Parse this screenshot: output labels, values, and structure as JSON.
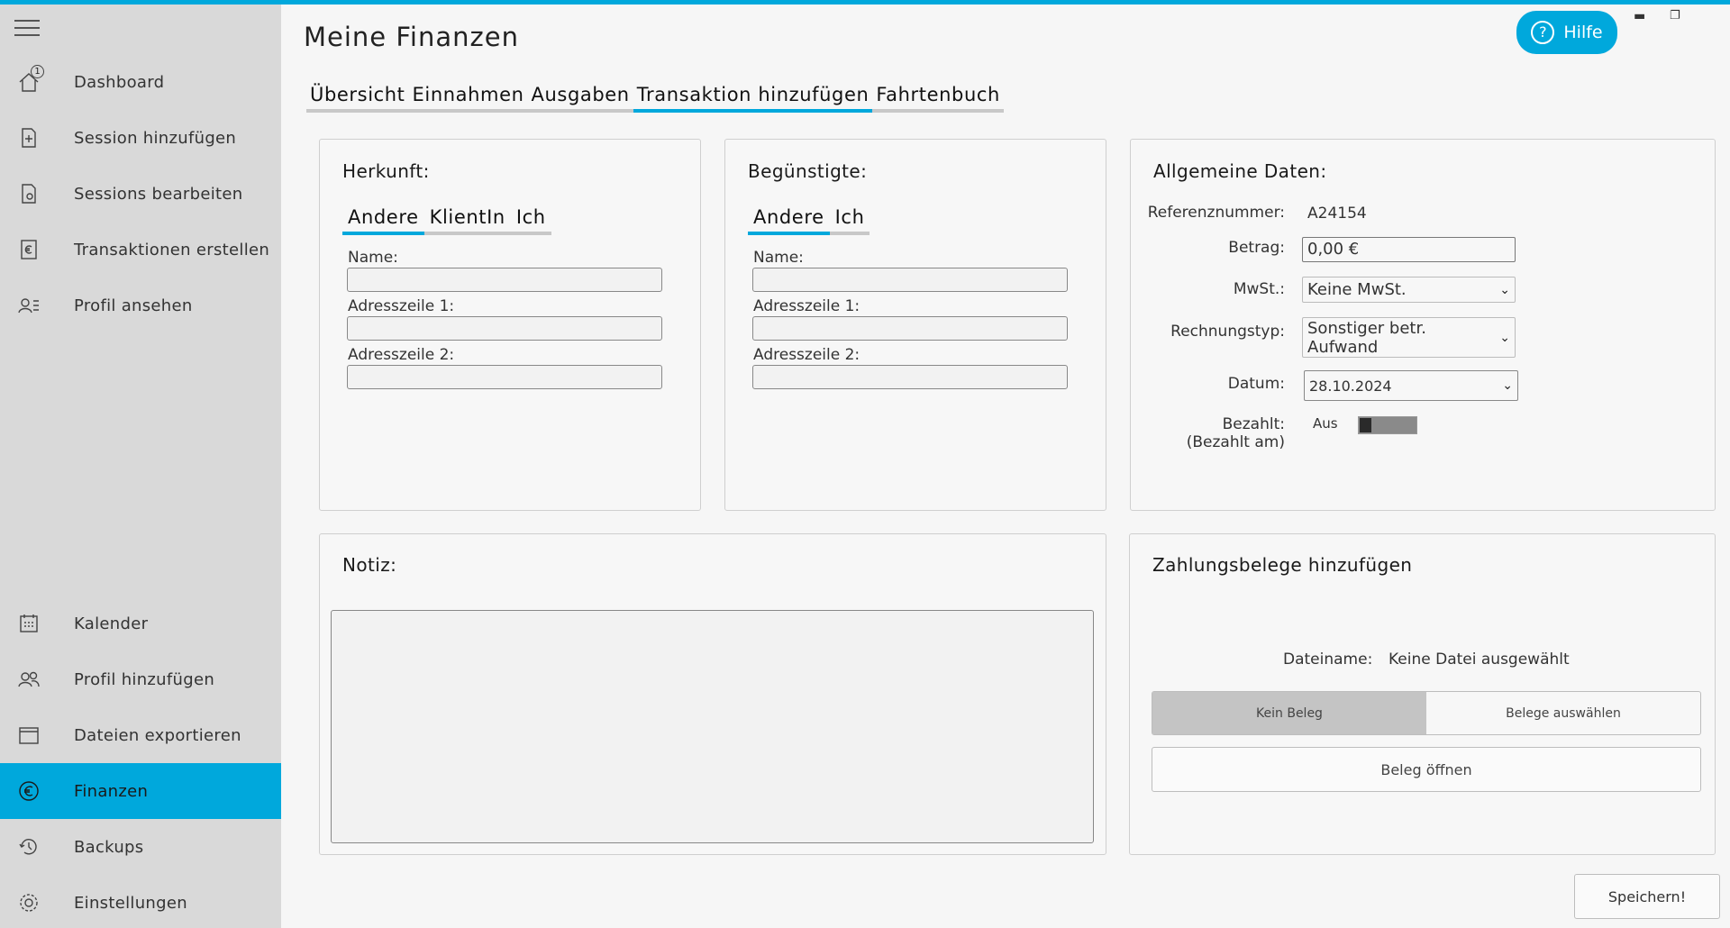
{
  "app": {
    "title": "Meine Finanzen",
    "help_label": "Hilfe"
  },
  "sidebar": {
    "top_items": [
      {
        "label": "Dashboard",
        "icon": "home-icon",
        "badge": "1"
      },
      {
        "label": "Session hinzufügen",
        "icon": "document-plus-icon"
      },
      {
        "label": "Sessions bearbeiten",
        "icon": "document-edit-icon"
      },
      {
        "label": "Transaktionen erstellen",
        "icon": "euro-document-icon"
      },
      {
        "label": "Profil ansehen",
        "icon": "profile-list-icon"
      }
    ],
    "bottom_items": [
      {
        "label": "Kalender",
        "icon": "calendar-icon"
      },
      {
        "label": "Profil hinzufügen",
        "icon": "add-person-icon"
      },
      {
        "label": "Dateien exportieren",
        "icon": "archive-icon"
      },
      {
        "label": "Finanzen",
        "icon": "euro-icon",
        "active": true
      },
      {
        "label": "Backups",
        "icon": "history-icon"
      },
      {
        "label": "Einstellungen",
        "icon": "gear-icon"
      }
    ]
  },
  "tabs": [
    "Übersicht",
    "Einnahmen",
    "Ausgaben",
    "Transaktion hinzufügen",
    "Fahrtenbuch"
  ],
  "herkunft": {
    "title": "Herkunft:",
    "subtabs": [
      "Andere",
      "KlientIn",
      "Ich"
    ],
    "fields": [
      "Name:",
      "Adresszeile 1:",
      "Adresszeile 2:"
    ]
  },
  "beguenstigte": {
    "title": "Begünstigte:",
    "subtabs": [
      "Andere",
      "Ich"
    ],
    "fields": [
      "Name:",
      "Adresszeile 1:",
      "Adresszeile 2:"
    ]
  },
  "allgemein": {
    "title": "Allgemeine Daten:",
    "referenz_label": "Referenznummer:",
    "referenz_value": "A24154",
    "betrag_label": "Betrag:",
    "betrag_value": "0,00 €",
    "mwst_label": "MwSt.:",
    "mwst_value": "Keine MwSt.",
    "rechnungstyp_label": "Rechnungstyp:",
    "rechnungstyp_value": "Sonstiger betr. Aufwand",
    "datum_label": "Datum:",
    "datum_value": "28.10.2024",
    "bezahlt_label": "Bezahlt:",
    "bezahlt_sub": "(Bezahlt am)",
    "toggle_label": "Aus"
  },
  "notiz": {
    "title": "Notiz:"
  },
  "belege": {
    "title": "Zahlungsbelege hinzufügen",
    "dateiname_label": "Dateiname:",
    "dateiname_value": "Keine Datei ausgewählt",
    "kein_beleg": "Kein Beleg",
    "belege_auswaehlen": "Belege auswählen",
    "beleg_oeffnen": "Beleg öffnen"
  },
  "save_label": "Speichern!",
  "colors": {
    "accent": "#00a8dc",
    "sidebar_bg": "#d9d9d9"
  }
}
